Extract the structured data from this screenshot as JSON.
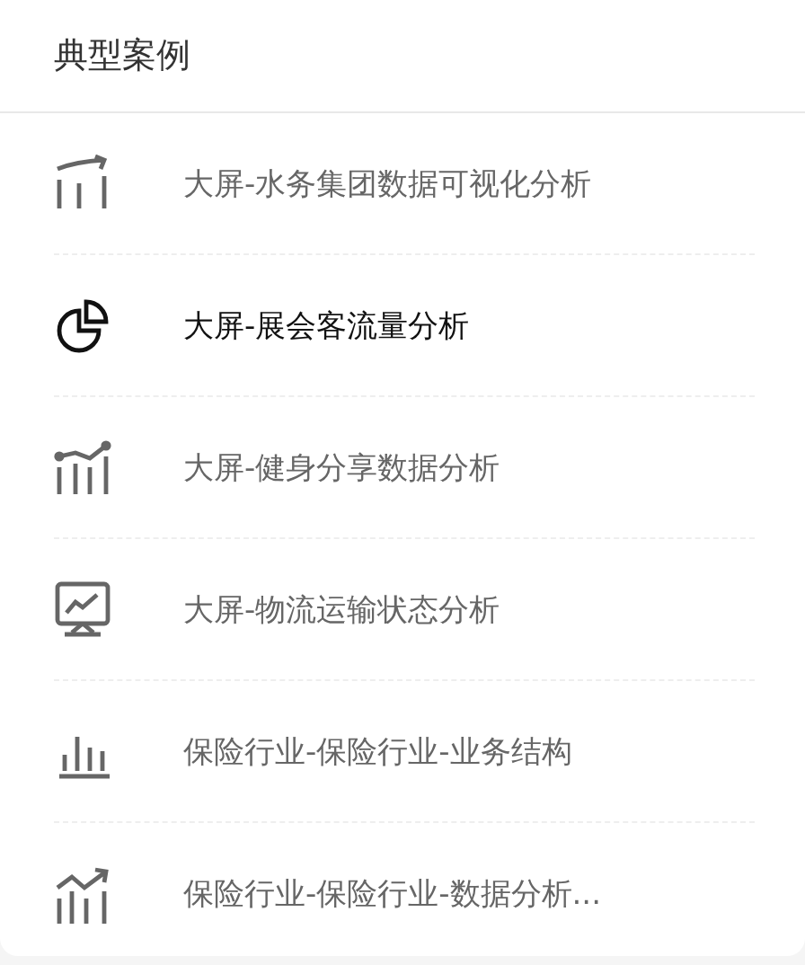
{
  "panel": {
    "title": "典型案例"
  },
  "cases": [
    {
      "kind": "trend-arrow",
      "label": "大屏-水务集团数据可视化分析",
      "selected": false
    },
    {
      "kind": "pie",
      "label": "大屏-展会客流量分析",
      "selected": true
    },
    {
      "kind": "bars-line",
      "label": "大屏-健身分享数据分析",
      "selected": false
    },
    {
      "kind": "monitor",
      "label": "大屏-物流运输状态分析",
      "selected": false
    },
    {
      "kind": "bar-chart",
      "label": "保险行业-保险行业-业务结构",
      "selected": false
    },
    {
      "kind": "bars-arrow",
      "label": "保险行业-保险行业-数据分析...",
      "selected": false
    }
  ]
}
